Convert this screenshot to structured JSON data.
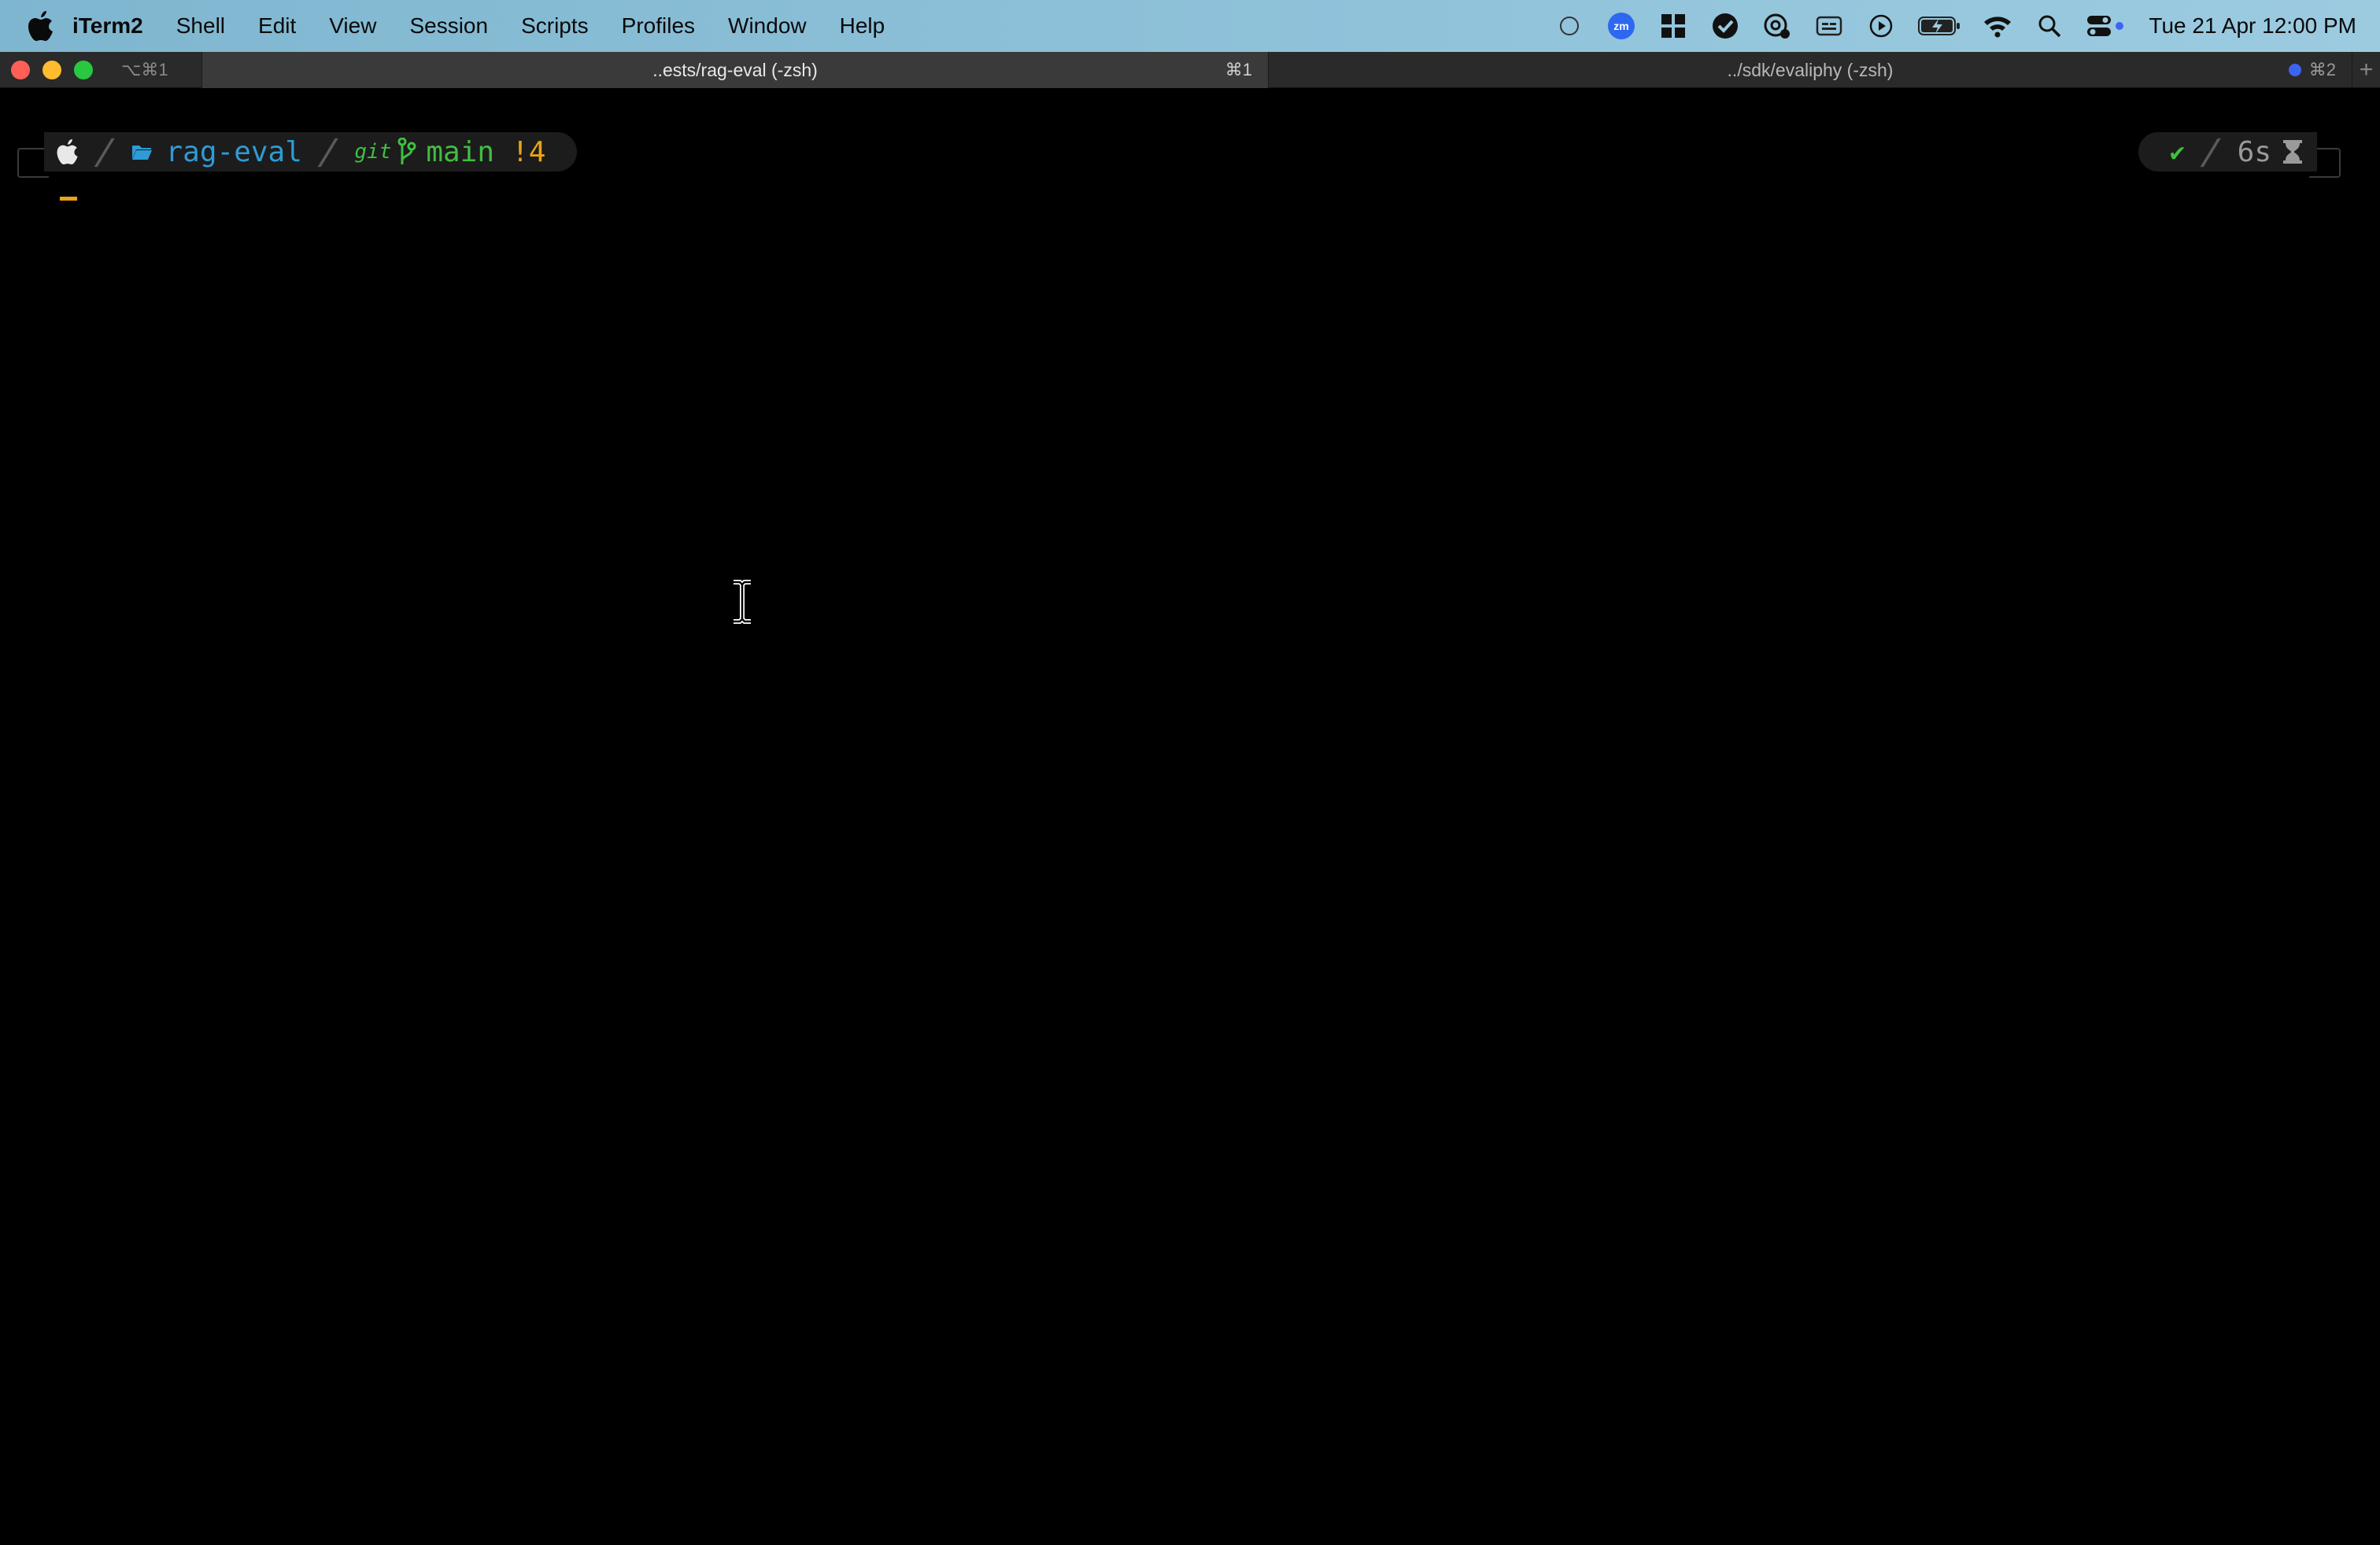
{
  "menubar": {
    "app_name": "iTerm2",
    "menus": [
      "Shell",
      "Edit",
      "View",
      "Session",
      "Scripts",
      "Profiles",
      "Window",
      "Help"
    ],
    "status_icons": [
      "circle-status-icon",
      "zoom-icon",
      "grid-app-icon",
      "checkmark-circle-icon",
      "vpn-icon",
      "caption-icon",
      "play-circle-icon",
      "battery-charging-icon",
      "wifi-icon",
      "spotlight-search-icon",
      "control-center-icon"
    ],
    "zoom_label": "zm",
    "clock": "Tue 21 Apr  12:00 PM"
  },
  "tabbar": {
    "first_shortcut": "⌥⌘1",
    "tabs": [
      {
        "title": "..ests/rag-eval (-zsh)",
        "shortcut": "⌘1",
        "active": true
      },
      {
        "title": "../sdk/evaliphy (-zsh)",
        "shortcut": "⌘2",
        "active": false,
        "has_activity_dot": true
      }
    ],
    "new_tab": "+"
  },
  "prompt": {
    "os_icon": "apple-icon",
    "directory": "rag-eval",
    "vcs_label": "git",
    "branch": "main",
    "dirty_count": "!4",
    "status_ok": "✔",
    "duration": "6s",
    "duration_icon": "hourglass-icon"
  },
  "colors": {
    "dir": "#2e9bd6",
    "git": "#3fbf3f",
    "dirty": "#e8a317",
    "cursor": "#e8a317"
  }
}
